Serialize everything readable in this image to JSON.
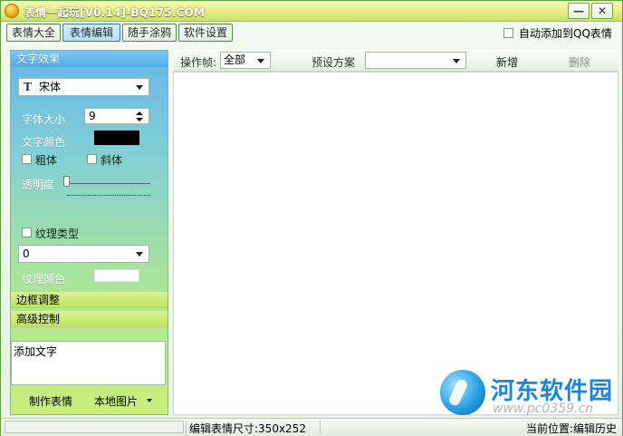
{
  "window": {
    "title": "表情一起玩[V0.14]-BQ175.COM",
    "controls": {
      "minimize": "—",
      "close": "✕"
    }
  },
  "tabs": [
    {
      "label": "表情大全",
      "active": false
    },
    {
      "label": "表情编辑",
      "active": true
    },
    {
      "label": "随手涂鸦",
      "active": false
    },
    {
      "label": "软件设置",
      "active": false
    }
  ],
  "auto_add": {
    "label": "自动添加到QQ表情",
    "checked": false
  },
  "left_panel": {
    "sections": {
      "text_effects": "文字效果",
      "border_adjust": "边框调整",
      "advanced_control": "高级控制"
    },
    "font": {
      "value": "宋体",
      "icon": "tt-font-icon"
    },
    "font_size": {
      "label": "字体大小",
      "value": "9"
    },
    "text_color": {
      "label": "文字颜色",
      "value": "#000000"
    },
    "bold": {
      "label": "粗体",
      "checked": false
    },
    "italic": {
      "label": "斜体",
      "checked": false
    },
    "opacity": {
      "label": "透明度",
      "level": 0
    },
    "texture_type": {
      "label": "纹理类型",
      "checked": false,
      "value": "0"
    },
    "texture_color": {
      "label": "纹理颜色",
      "value": "#ffffff"
    },
    "text_input": {
      "value": "添加文字"
    },
    "actions": {
      "make_emoticon": "制作表情",
      "local_image": "本地图片"
    }
  },
  "toolbar": {
    "operation_label": "操作帧:",
    "operation_value": "全部",
    "preset_label": "预设方案",
    "preset_value": "",
    "add_label": "新增",
    "delete_label": "删除"
  },
  "status": {
    "edit_size": "编辑表情尺寸:350x252",
    "current_position": "当前位置:编辑历史"
  },
  "watermark": {
    "name": "河东软件园",
    "url": "www.pc0359.cn"
  },
  "colors": {
    "accent_green": "#5f9f3f",
    "panel_blue": "#64b6e8",
    "panel_green": "#c9ef7a",
    "watermark_blue": "#1a86d6"
  }
}
